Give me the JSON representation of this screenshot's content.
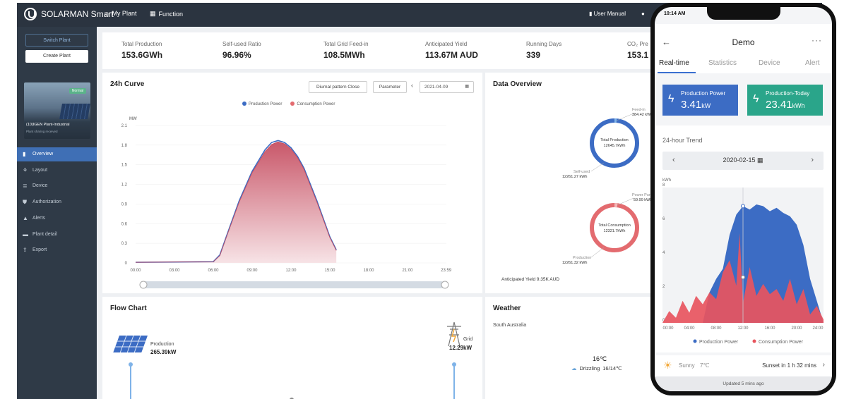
{
  "app": {
    "brand": "SOLARMAN Smart"
  },
  "topnav": {
    "my_plant": "My Plant",
    "function": "Function",
    "user_manual": "User Manual"
  },
  "sidebar": {
    "switch_plant": "Switch Plant",
    "create_plant": "Create Plant",
    "plant": {
      "status": "Normal",
      "name": "(10)IGEN Plant-Industrial",
      "subtitle": "Plant sharing received"
    },
    "items": [
      {
        "label": "Overview",
        "icon": "bar-chart-icon",
        "active": true
      },
      {
        "label": "Layout",
        "icon": "layout-icon"
      },
      {
        "label": "Device",
        "icon": "list-icon"
      },
      {
        "label": "Authorization",
        "icon": "shield-icon"
      },
      {
        "label": "Alerts",
        "icon": "alert-icon"
      },
      {
        "label": "Plant detail",
        "icon": "folder-icon"
      },
      {
        "label": "Export",
        "icon": "export-icon"
      }
    ]
  },
  "stats": [
    {
      "label": "Total Production",
      "value": "153.6GWh"
    },
    {
      "label": "Self-used Ratio",
      "value": "96.96%"
    },
    {
      "label": "Total Grid Feed-in",
      "value": "108.5MWh"
    },
    {
      "label": "Anticipated Yield",
      "value": "113.67M AUD"
    },
    {
      "label": "Running Days",
      "value": "339"
    },
    {
      "label": "CO₂ Pre",
      "value": "153.1"
    }
  ],
  "curve": {
    "title": "24h Curve",
    "diurnal_btn": "Diurnal pattern Close",
    "param_btn": "Parameter",
    "date": "2021-04-09",
    "legend": [
      "Production Power",
      "Consumption Power"
    ],
    "colors": {
      "production": "#3c6cc4",
      "consumption": "#e36b6f"
    }
  },
  "chart_data": {
    "type": "area",
    "ylabel": "MW",
    "ylim": [
      0,
      2.1
    ],
    "yticks": [
      "0",
      "0.3",
      "0.6",
      "0.9",
      "1.2",
      "1.5",
      "1.8",
      "2.1"
    ],
    "xticks": [
      "00:00",
      "03:00",
      "06:00",
      "09:00",
      "12:00",
      "15:00",
      "18:00",
      "21:00",
      "23:59"
    ],
    "x_hours": [
      0,
      6,
      6.5,
      7,
      8,
      9,
      10,
      10.5,
      11,
      11.5,
      12,
      12.5,
      13,
      14,
      15,
      15.5
    ],
    "series": [
      {
        "name": "Production Power",
        "values": [
          0.01,
          0.02,
          0.12,
          0.4,
          0.95,
          1.4,
          1.73,
          1.84,
          1.87,
          1.84,
          1.76,
          1.63,
          1.45,
          0.95,
          0.4,
          0.2
        ]
      },
      {
        "name": "Consumption Power",
        "values": [
          0.01,
          0.02,
          0.11,
          0.39,
          0.93,
          1.38,
          1.7,
          1.81,
          1.85,
          1.82,
          1.74,
          1.61,
          1.43,
          0.93,
          0.39,
          0.19
        ]
      }
    ]
  },
  "overview": {
    "title": "Data Overview",
    "production": {
      "center_label": "Total Production",
      "center_value": "12645.7kWh",
      "feed_label": "Feed-in",
      "feed_value": "384.42 kWh",
      "self_label": "Self-used",
      "self_value": "12261.27 kWh"
    },
    "consumption": {
      "center_label": "Total Consumption",
      "center_value": "12321.7kWh",
      "purchase_label": "Power Purchase",
      "purchase_value": "59.99 kWh",
      "prod_label": "Production",
      "prod_value": "12261.32 kWh"
    },
    "anticipated": "Anticipated Yield 9.35K AUD"
  },
  "flow": {
    "title": "Flow Chart",
    "production_label": "Production",
    "production_value": "265.39kW",
    "grid_label": "Grid",
    "grid_value": "12.29kW"
  },
  "weather": {
    "title": "Weather",
    "location": "South Australia",
    "temp": "16℃",
    "condition": "Drizzling",
    "range": "16/14℃"
  },
  "phone": {
    "time": "10:14 AM",
    "title": "Demo",
    "tabs": [
      "Real-time",
      "Statistics",
      "Device",
      "Alert"
    ],
    "card_power": {
      "label": "Production Power",
      "value": "3.41",
      "unit": "kW",
      "color": "#3c6cc4"
    },
    "card_today": {
      "label": "Production-Today",
      "value": "23.41",
      "unit": "kWh",
      "color": "#2aa58a"
    },
    "trend_title": "24-hour Trend",
    "date": "2020-02-15",
    "chart": {
      "ylabel": "kWh",
      "yticks": [
        "0",
        "2",
        "4",
        "6",
        "8"
      ],
      "xticks": [
        "00:00",
        "04:00",
        "08:00",
        "12:00",
        "16:00",
        "20:00",
        "24:00"
      ],
      "legend": [
        "Production Power",
        "Consumption Power"
      ]
    },
    "weather": "Sunny",
    "weather_temp": "7℃",
    "sunset": "Sunset in 1 h 32 mins",
    "updated": "Updated 5 mins ago"
  }
}
